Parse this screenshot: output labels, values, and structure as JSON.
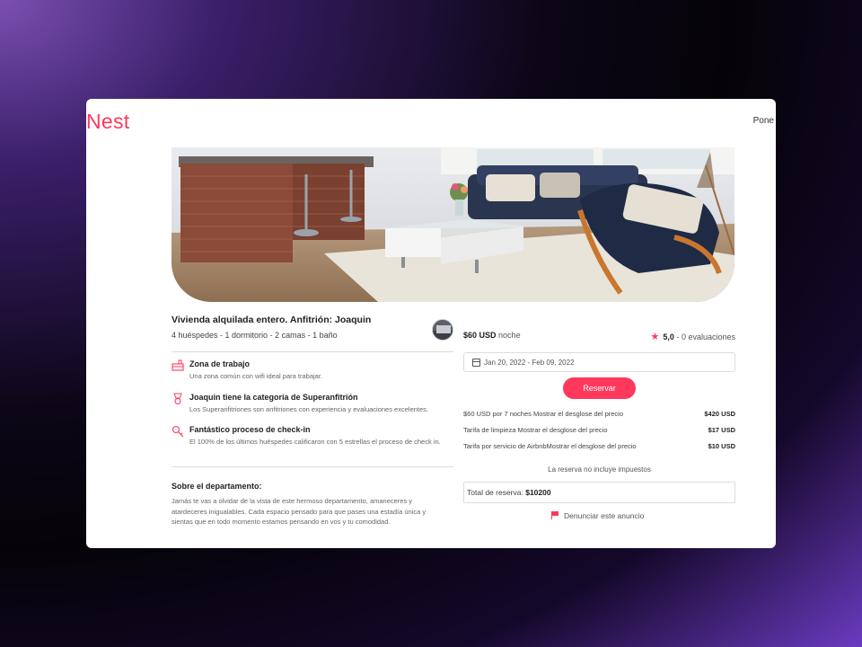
{
  "header": {
    "logo": "Nest",
    "top_right": "Pone"
  },
  "listing": {
    "title": "Vivienda alquilada entero. Anfitrión: Joaquin",
    "subtitle": "4 huéspedes - 1 dormitorio - 2 camas - 1 baño"
  },
  "features": [
    {
      "icon": "desk-icon",
      "title": "Zona de trabajo",
      "desc": "Una zona común con wifi ideal para trabajar."
    },
    {
      "icon": "medal-icon",
      "title": "Joaquin tiene la categoría de Superanfitrión",
      "desc": "Los Superanfitriones son anfitriones con experiencia y evaluaciones excelentes."
    },
    {
      "icon": "key-icon",
      "title": "Fantástico proceso de check-in",
      "desc": "El 100% de los últimos huéspedes calificaron con 5 estrellas el proceso de check in."
    }
  ],
  "about": {
    "title": "Sobre el departamento:",
    "text": "Jamás te vas a olvidar de la vista de este hermoso departamento, amaneceres y atardeceres inigualables. Cada espacio pensado para que pases una estadía única y sientas que en todo momento estamos pensando en vos y tu comodidad."
  },
  "booking": {
    "price": "$60 USD",
    "per_night": "noche",
    "rating": "5,0",
    "reviews": "- 0 evaluaciones",
    "dates": "Jan 20, 2022 - Feb 09, 2022",
    "reserve_label": "Reservar",
    "fees": [
      {
        "label": "$60 USD por 7 noches Mostrar el desglose del precio",
        "amount": "$420 USD"
      },
      {
        "label": "Tarifa de limpieza Mostrar el desglose del precio",
        "amount": "$17 USD"
      },
      {
        "label": "Tarifa por servicio de AirbnbMostrar el desglose del precio",
        "amount": "$10 USD"
      }
    ],
    "no_tax": "La reserva no incluye impuestos",
    "total_label": "Total de reserva:",
    "total_value": "$10200",
    "report": "Denunciar este anuncio"
  },
  "colors": {
    "accent": "#ff385c",
    "card_bg": "#ffffff"
  }
}
